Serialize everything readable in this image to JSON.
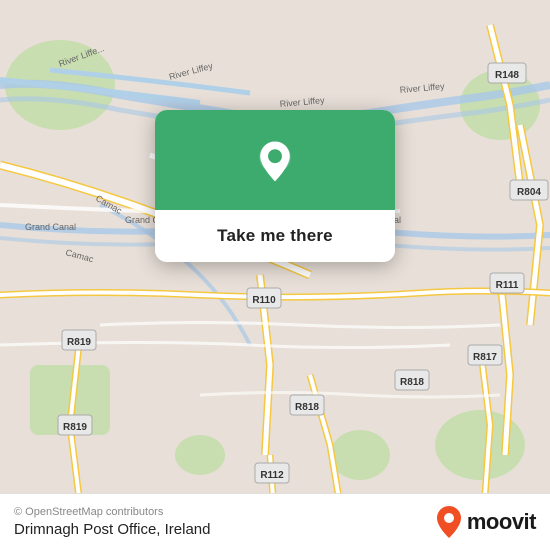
{
  "map": {
    "background_color": "#e8e0d8",
    "center_lat": 53.334,
    "center_lng": -6.318
  },
  "popup": {
    "button_label": "Take me there",
    "pin_icon": "location-pin-icon"
  },
  "bottom_bar": {
    "copyright": "© OpenStreetMap contributors",
    "location_name": "Drimnagh Post Office, Ireland",
    "logo_text": "moovit"
  },
  "roads": {
    "accent_color": "#f5c842",
    "road_color": "#ffffff",
    "road_outline": "#d0c8b8"
  }
}
